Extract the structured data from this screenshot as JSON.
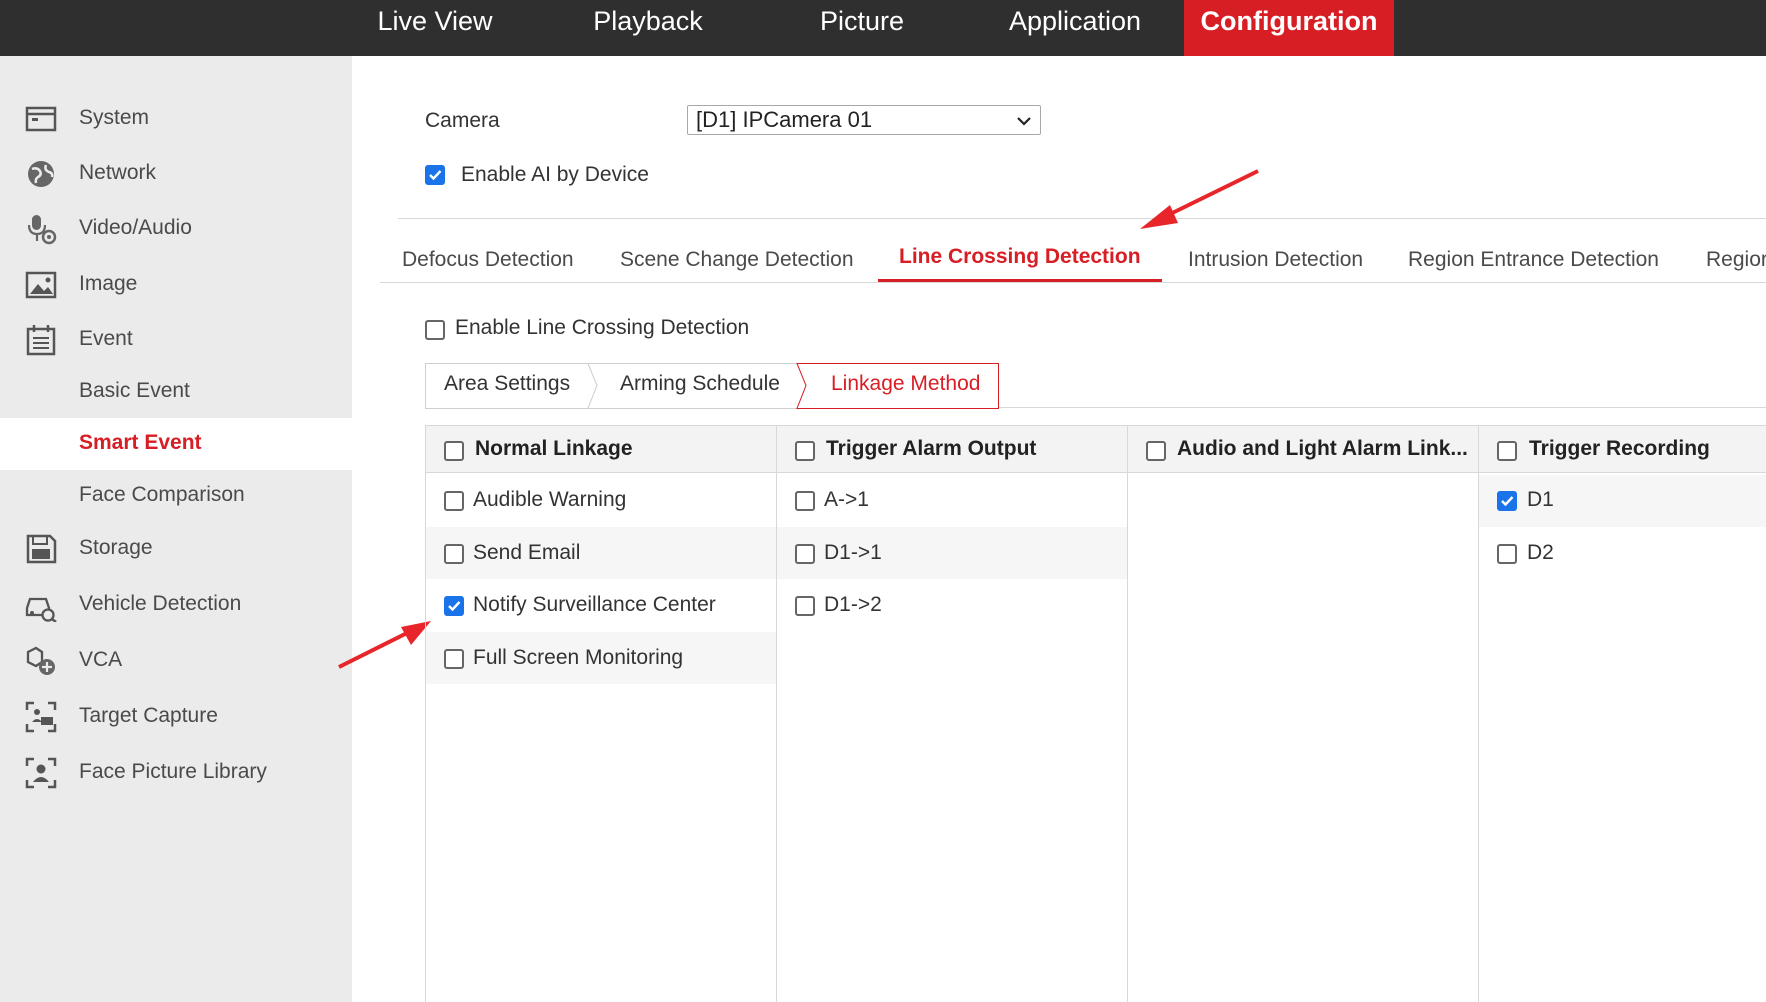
{
  "topnav": {
    "items": [
      {
        "label": "Live View"
      },
      {
        "label": "Playback"
      },
      {
        "label": "Picture"
      },
      {
        "label": "Application"
      },
      {
        "label": "Configuration",
        "active": true
      }
    ]
  },
  "sidebar": {
    "items": [
      {
        "label": "System",
        "icon": "system-icon"
      },
      {
        "label": "Network",
        "icon": "globe-icon"
      },
      {
        "label": "Video/Audio",
        "icon": "microphone-camera-icon"
      },
      {
        "label": "Image",
        "icon": "image-icon"
      },
      {
        "label": "Event",
        "icon": "calendar-icon"
      },
      {
        "label": "Basic Event"
      },
      {
        "label": "Smart Event",
        "selected": true
      },
      {
        "label": "Face Comparison"
      },
      {
        "label": "Storage",
        "icon": "save-icon"
      },
      {
        "label": "Vehicle Detection",
        "icon": "car-search-icon"
      },
      {
        "label": "VCA",
        "icon": "vca-icon"
      },
      {
        "label": "Target Capture",
        "icon": "target-capture-icon"
      },
      {
        "label": "Face Picture Library",
        "icon": "face-library-icon"
      }
    ]
  },
  "camera": {
    "label": "Camera",
    "selected": "[D1] IPCamera 01"
  },
  "enable_ai": {
    "label": "Enable AI by Device",
    "checked": true
  },
  "detection_tabs": [
    {
      "label": "Defocus Detection"
    },
    {
      "label": "Scene Change Detection"
    },
    {
      "label": "Line Crossing Detection",
      "active": true
    },
    {
      "label": "Intrusion Detection"
    },
    {
      "label": "Region Entrance Detection"
    },
    {
      "label": "Regior"
    }
  ],
  "enable_line_crossing": {
    "label": "Enable Line Crossing Detection",
    "checked": false
  },
  "step_tabs": [
    {
      "label": "Area Settings"
    },
    {
      "label": "Arming Schedule"
    },
    {
      "label": "Linkage Method",
      "active": true
    }
  ],
  "linkage": {
    "columns": [
      {
        "header": "Normal Linkage",
        "items": [
          {
            "label": "Audible Warning",
            "checked": false
          },
          {
            "label": "Send Email",
            "checked": false
          },
          {
            "label": "Notify Surveillance Center",
            "checked": true
          },
          {
            "label": "Full Screen Monitoring",
            "checked": false
          }
        ]
      },
      {
        "header": "Trigger Alarm Output",
        "items": [
          {
            "label": "A->1",
            "checked": false
          },
          {
            "label": "D1->1",
            "checked": false
          },
          {
            "label": "D1->2",
            "checked": false
          }
        ]
      },
      {
        "header": "Audio and Light Alarm Link...",
        "items": []
      },
      {
        "header": "Trigger Recording",
        "items": [
          {
            "label": "D1",
            "checked": true
          },
          {
            "label": "D2",
            "checked": false
          }
        ]
      }
    ]
  },
  "colors": {
    "accent": "#d81e25",
    "checkbox": "#1a73e8",
    "topbar": "#2f2f2f",
    "sidebar": "#ebebeb"
  }
}
